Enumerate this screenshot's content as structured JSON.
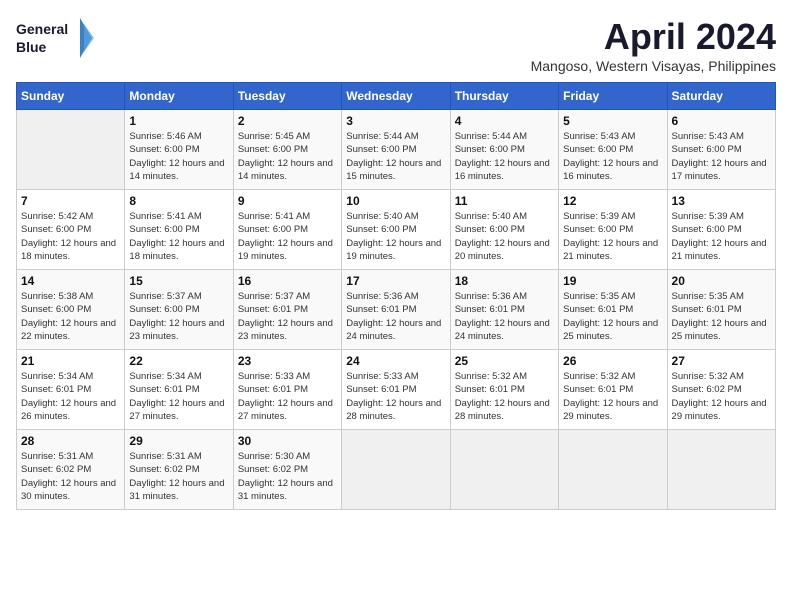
{
  "header": {
    "logo_line1": "General",
    "logo_line2": "Blue",
    "title": "April 2024",
    "location": "Mangoso, Western Visayas, Philippines"
  },
  "weekdays": [
    "Sunday",
    "Monday",
    "Tuesday",
    "Wednesday",
    "Thursday",
    "Friday",
    "Saturday"
  ],
  "weeks": [
    [
      {
        "day": null
      },
      {
        "day": "1",
        "sunrise": "5:46 AM",
        "sunset": "6:00 PM",
        "daylight": "12 hours and 14 minutes."
      },
      {
        "day": "2",
        "sunrise": "5:45 AM",
        "sunset": "6:00 PM",
        "daylight": "12 hours and 14 minutes."
      },
      {
        "day": "3",
        "sunrise": "5:44 AM",
        "sunset": "6:00 PM",
        "daylight": "12 hours and 15 minutes."
      },
      {
        "day": "4",
        "sunrise": "5:44 AM",
        "sunset": "6:00 PM",
        "daylight": "12 hours and 16 minutes."
      },
      {
        "day": "5",
        "sunrise": "5:43 AM",
        "sunset": "6:00 PM",
        "daylight": "12 hours and 16 minutes."
      },
      {
        "day": "6",
        "sunrise": "5:43 AM",
        "sunset": "6:00 PM",
        "daylight": "12 hours and 17 minutes."
      }
    ],
    [
      {
        "day": "7",
        "sunrise": "5:42 AM",
        "sunset": "6:00 PM",
        "daylight": "12 hours and 18 minutes."
      },
      {
        "day": "8",
        "sunrise": "5:41 AM",
        "sunset": "6:00 PM",
        "daylight": "12 hours and 18 minutes."
      },
      {
        "day": "9",
        "sunrise": "5:41 AM",
        "sunset": "6:00 PM",
        "daylight": "12 hours and 19 minutes."
      },
      {
        "day": "10",
        "sunrise": "5:40 AM",
        "sunset": "6:00 PM",
        "daylight": "12 hours and 19 minutes."
      },
      {
        "day": "11",
        "sunrise": "5:40 AM",
        "sunset": "6:00 PM",
        "daylight": "12 hours and 20 minutes."
      },
      {
        "day": "12",
        "sunrise": "5:39 AM",
        "sunset": "6:00 PM",
        "daylight": "12 hours and 21 minutes."
      },
      {
        "day": "13",
        "sunrise": "5:39 AM",
        "sunset": "6:00 PM",
        "daylight": "12 hours and 21 minutes."
      }
    ],
    [
      {
        "day": "14",
        "sunrise": "5:38 AM",
        "sunset": "6:00 PM",
        "daylight": "12 hours and 22 minutes."
      },
      {
        "day": "15",
        "sunrise": "5:37 AM",
        "sunset": "6:00 PM",
        "daylight": "12 hours and 23 minutes."
      },
      {
        "day": "16",
        "sunrise": "5:37 AM",
        "sunset": "6:01 PM",
        "daylight": "12 hours and 23 minutes."
      },
      {
        "day": "17",
        "sunrise": "5:36 AM",
        "sunset": "6:01 PM",
        "daylight": "12 hours and 24 minutes."
      },
      {
        "day": "18",
        "sunrise": "5:36 AM",
        "sunset": "6:01 PM",
        "daylight": "12 hours and 24 minutes."
      },
      {
        "day": "19",
        "sunrise": "5:35 AM",
        "sunset": "6:01 PM",
        "daylight": "12 hours and 25 minutes."
      },
      {
        "day": "20",
        "sunrise": "5:35 AM",
        "sunset": "6:01 PM",
        "daylight": "12 hours and 25 minutes."
      }
    ],
    [
      {
        "day": "21",
        "sunrise": "5:34 AM",
        "sunset": "6:01 PM",
        "daylight": "12 hours and 26 minutes."
      },
      {
        "day": "22",
        "sunrise": "5:34 AM",
        "sunset": "6:01 PM",
        "daylight": "12 hours and 27 minutes."
      },
      {
        "day": "23",
        "sunrise": "5:33 AM",
        "sunset": "6:01 PM",
        "daylight": "12 hours and 27 minutes."
      },
      {
        "day": "24",
        "sunrise": "5:33 AM",
        "sunset": "6:01 PM",
        "daylight": "12 hours and 28 minutes."
      },
      {
        "day": "25",
        "sunrise": "5:32 AM",
        "sunset": "6:01 PM",
        "daylight": "12 hours and 28 minutes."
      },
      {
        "day": "26",
        "sunrise": "5:32 AM",
        "sunset": "6:01 PM",
        "daylight": "12 hours and 29 minutes."
      },
      {
        "day": "27",
        "sunrise": "5:32 AM",
        "sunset": "6:02 PM",
        "daylight": "12 hours and 29 minutes."
      }
    ],
    [
      {
        "day": "28",
        "sunrise": "5:31 AM",
        "sunset": "6:02 PM",
        "daylight": "12 hours and 30 minutes."
      },
      {
        "day": "29",
        "sunrise": "5:31 AM",
        "sunset": "6:02 PM",
        "daylight": "12 hours and 31 minutes."
      },
      {
        "day": "30",
        "sunrise": "5:30 AM",
        "sunset": "6:02 PM",
        "daylight": "12 hours and 31 minutes."
      },
      {
        "day": null
      },
      {
        "day": null
      },
      {
        "day": null
      },
      {
        "day": null
      }
    ]
  ],
  "labels": {
    "sunrise": "Sunrise:",
    "sunset": "Sunset:",
    "daylight": "Daylight:"
  }
}
